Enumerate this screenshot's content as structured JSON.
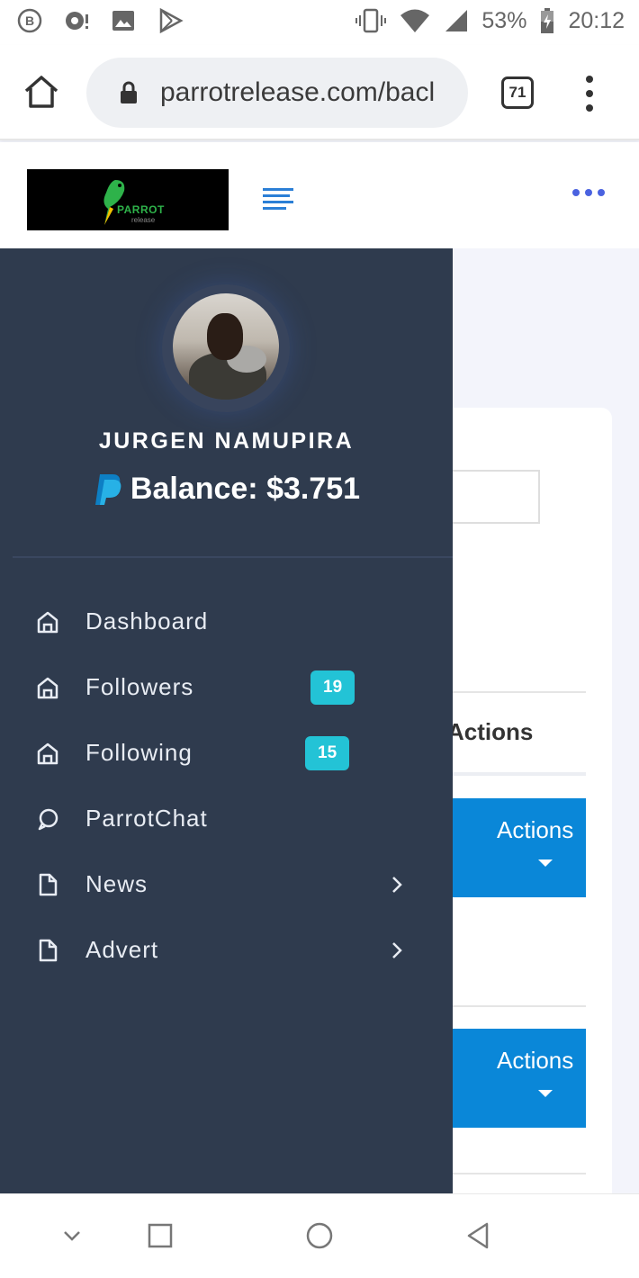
{
  "status_bar": {
    "icons_left": [
      "b-badge-icon",
      "camera-icon",
      "image-icon",
      "play-store-icon"
    ],
    "battery_percent": "53%",
    "time": "20:12"
  },
  "browser": {
    "url": "parrotrelease.com/bacl",
    "tab_count": "71"
  },
  "site": {
    "logo_text": "PARROT",
    "logo_subtext": "release"
  },
  "profile": {
    "name": "JURGEN NAMUPIRA",
    "balance": "Balance: $3.751"
  },
  "nav": {
    "items": [
      {
        "label": "Dashboard",
        "icon": "home-icon"
      },
      {
        "label": "Followers",
        "icon": "home-icon",
        "badge": "19"
      },
      {
        "label": "Following",
        "icon": "home-icon",
        "badge": "15"
      },
      {
        "label": "ParrotChat",
        "icon": "chat-icon"
      },
      {
        "label": "News",
        "icon": "file-icon",
        "has_submenu": true
      },
      {
        "label": "Advert",
        "icon": "file-icon",
        "has_submenu": true
      }
    ]
  },
  "background_content": {
    "column_header": "Actions",
    "action_buttons": [
      "Actions",
      "Actions"
    ]
  },
  "colors": {
    "sidebar_bg": "#2f3b4e",
    "badge": "#23c3d6",
    "action_button": "#0a87d8",
    "accent": "#4a62e0"
  }
}
